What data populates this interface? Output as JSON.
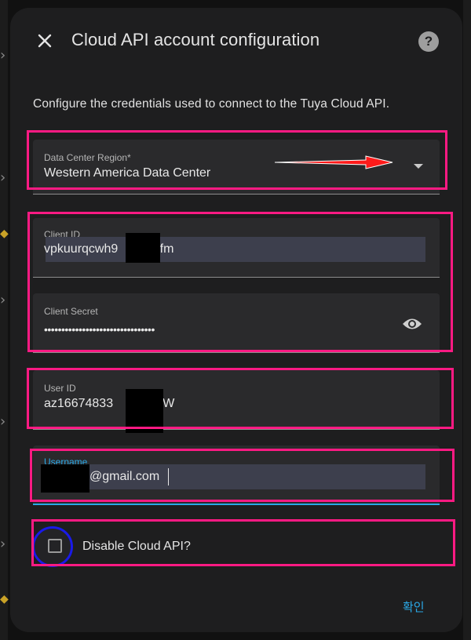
{
  "dialog": {
    "title": "Cloud API account configuration",
    "close_icon": "close-icon",
    "help_icon": "help-circle-icon",
    "help_glyph": "?",
    "description": "Configure the credentials used to connect to the Tuya Cloud API."
  },
  "fields": {
    "region": {
      "label": "Data Center Region*",
      "value": "Western America Data Center",
      "icon": "dropdown-arrow-icon"
    },
    "client_id": {
      "label": "Client ID",
      "value": "vpkuurqcwh9       7mfm"
    },
    "client_secret": {
      "label": "Client Secret",
      "value": "••••••••••••••••••••••••••••••••",
      "icon": "eye-icon"
    },
    "user_id": {
      "label": "User ID",
      "value": "az16674833      byYgW"
    },
    "username": {
      "label": "Username",
      "value": "@gmail.com"
    }
  },
  "checkbox": {
    "label": "Disable Cloud API?",
    "checked": false
  },
  "actions": {
    "confirm_label": "확인"
  },
  "colors": {
    "highlight": "#ff1a83",
    "annotation_arrow": "#ff1a1a",
    "annotation_circle": "#1a1ae8",
    "accent": "#2aa8e6"
  }
}
